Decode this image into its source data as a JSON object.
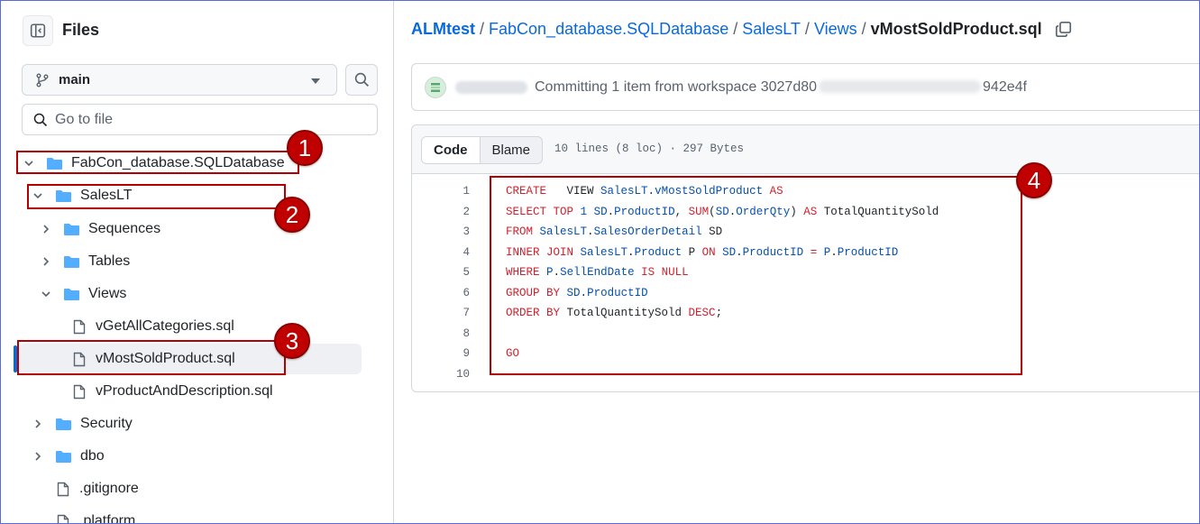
{
  "sidebar": {
    "title": "Files",
    "branch": "main",
    "goto_placeholder": "Go to file",
    "tree": [
      {
        "label": "FabCon_database.SQLDatabase",
        "type": "folder",
        "expanded": true
      },
      {
        "label": "SalesLT",
        "type": "folder",
        "expanded": true
      },
      {
        "label": "Sequences",
        "type": "folder",
        "expanded": false
      },
      {
        "label": "Tables",
        "type": "folder",
        "expanded": false
      },
      {
        "label": "Views",
        "type": "folder",
        "expanded": true
      },
      {
        "label": "vGetAllCategories.sql",
        "type": "file"
      },
      {
        "label": "vMostSoldProduct.sql",
        "type": "file",
        "selected": true
      },
      {
        "label": "vProductAndDescription.sql",
        "type": "file"
      },
      {
        "label": "Security",
        "type": "folder",
        "expanded": false
      },
      {
        "label": "dbo",
        "type": "folder",
        "expanded": false
      },
      {
        "label": ".gitignore",
        "type": "file"
      },
      {
        "label": ".platform",
        "type": "file"
      }
    ]
  },
  "breadcrumb": {
    "repo": "ALMtest",
    "p1": "FabCon_database.SQLDatabase",
    "p2": "SalesLT",
    "p3": "Views",
    "current": "vMostSoldProduct.sql",
    "sep": "/"
  },
  "commit": {
    "message_prefix": "Committing 1 item from workspace 3027d80",
    "message_suffix": "942e4f"
  },
  "code_view": {
    "tab_code": "Code",
    "tab_blame": "Blame",
    "meta": "10 lines (8 loc) · 297 Bytes",
    "line_numbers": [
      "1",
      "2",
      "3",
      "4",
      "5",
      "6",
      "7",
      "8",
      "9",
      "10"
    ]
  },
  "callouts": [
    "1",
    "2",
    "3",
    "4"
  ],
  "colors": {
    "accent": "#0969da",
    "keyword": "#cf222e",
    "identifier": "#0550ae",
    "callout": "#c00000"
  }
}
